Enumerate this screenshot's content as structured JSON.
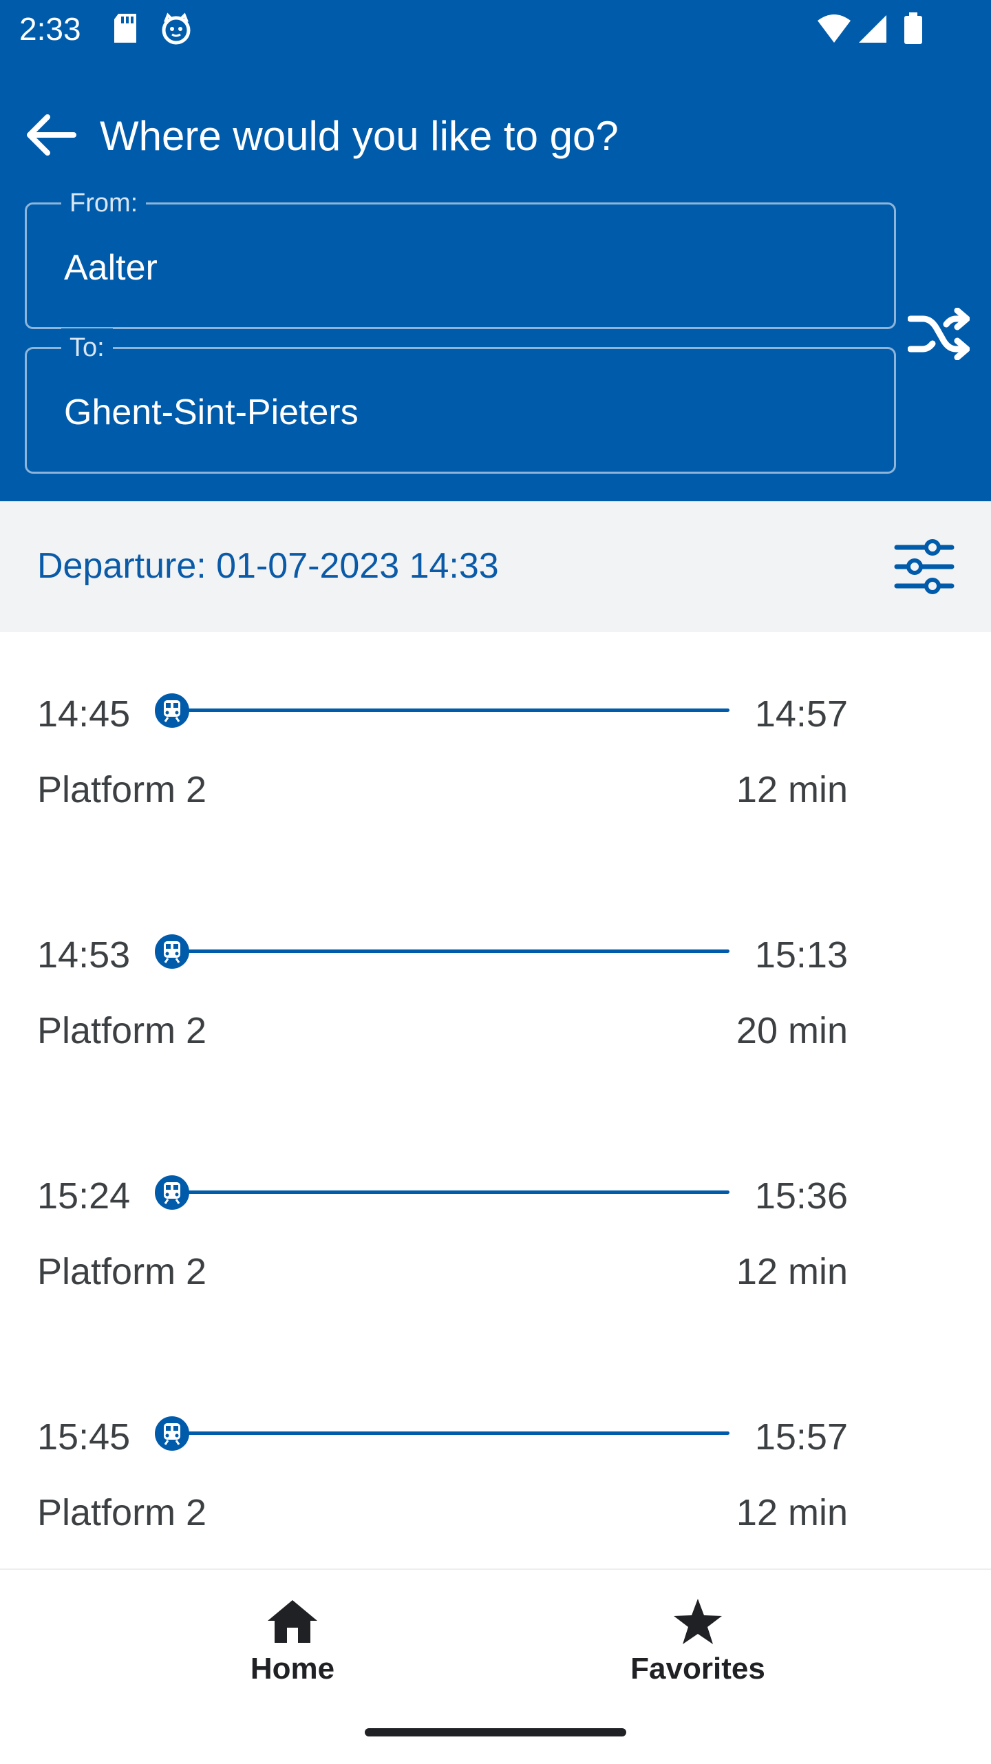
{
  "status_bar": {
    "time": "2:33"
  },
  "toolbar": {
    "title": "Where would you like to go?"
  },
  "from": {
    "label": "From:",
    "value": "Aalter"
  },
  "to": {
    "label": "To:",
    "value": "Ghent-Sint-Pieters"
  },
  "departure": {
    "text": "Departure: 01-07-2023 14:33"
  },
  "routes": [
    {
      "departure_time": "14:45",
      "arrival_time": "14:57",
      "platform": "Platform 2",
      "duration": "12 min"
    },
    {
      "departure_time": "14:53",
      "arrival_time": "15:13",
      "platform": "Platform 2",
      "duration": "20 min"
    },
    {
      "departure_time": "15:24",
      "arrival_time": "15:36",
      "platform": "Platform 2",
      "duration": "12 min"
    },
    {
      "departure_time": "15:45",
      "arrival_time": "15:57",
      "platform": "Platform 2",
      "duration": "12 min"
    }
  ],
  "bottom_nav": {
    "home": "Home",
    "favorites": "Favorites"
  },
  "colors": {
    "primary": "#005bab",
    "departure_text": "#0a5aa8",
    "departure_bar": "#f1f3f4"
  }
}
